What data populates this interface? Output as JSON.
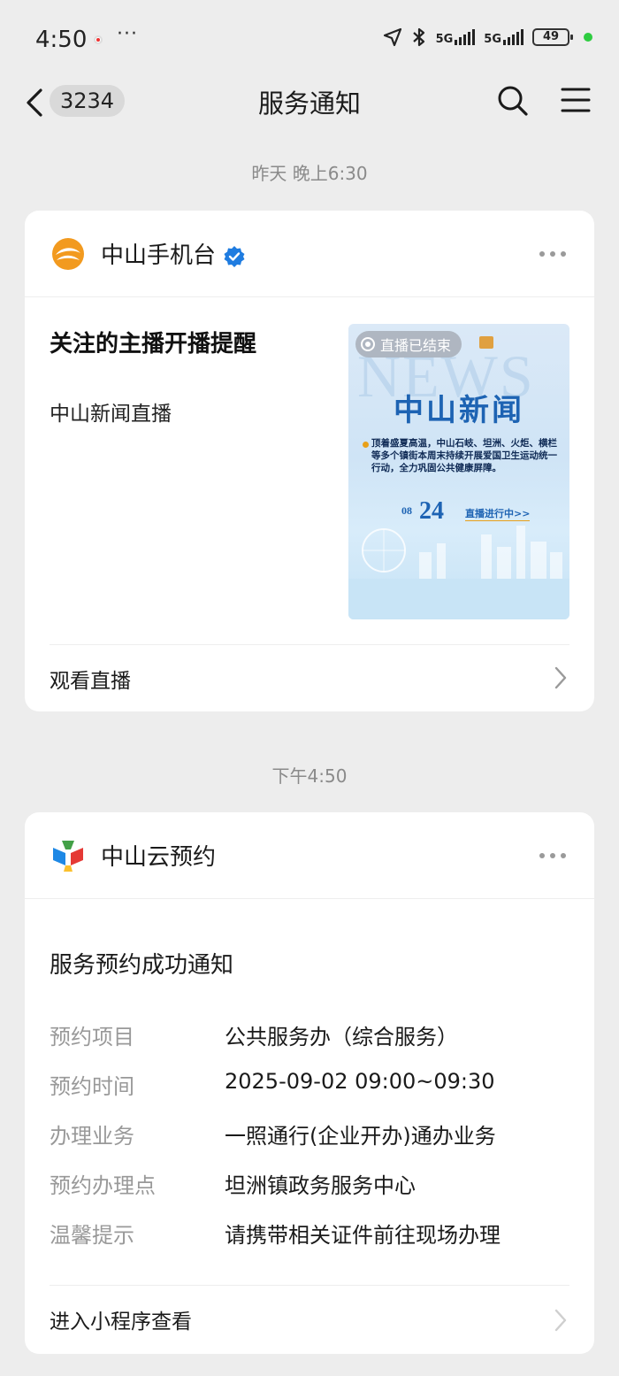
{
  "status_bar": {
    "time": "4:50",
    "more": "···",
    "signal1_label": "5G",
    "signal2_label": "5G",
    "battery": "49"
  },
  "nav": {
    "badge_count": "3234",
    "title": "服务通知"
  },
  "messages": [
    {
      "timestamp": "昨天 晚上6:30",
      "sender": "中山手机台",
      "title": "关注的主播开播提醒",
      "subtitle": "中山新闻直播",
      "thumbnail": {
        "live_status": "直播已结束",
        "watermark": "NEWS",
        "headline": "中山新闻",
        "text": "顶着盛夏高温，中山石岐、坦洲、火炬、横栏等多个镇街本周末持续开展爱国卫生运动统一行动，全力巩固公共健康屏障。",
        "month": "08",
        "day": "24",
        "link": "直播进行中>>"
      },
      "footer_action": "观看直播"
    },
    {
      "timestamp": "下午4:50",
      "sender": "中山云预约",
      "title": "服务预约成功通知",
      "fields": [
        {
          "label": "预约项目",
          "value": "公共服务办（综合服务）"
        },
        {
          "label": "预约时间",
          "value": "2025-09-02 09:00~09:30"
        },
        {
          "label": "办理业务",
          "value": "一照通行(企业开办)通办业务"
        },
        {
          "label": "预约办理点",
          "value": "坦洲镇政务服务中心"
        },
        {
          "label": "温馨提示",
          "value": "请携带相关证件前往现场办理"
        }
      ],
      "footer_action": "进入小程序查看"
    }
  ],
  "colors": {
    "background": "#ededed",
    "card": "#ffffff",
    "verified": "#1f7ce0",
    "thumb_title": "#1d63b3",
    "online": "#2ecc40"
  }
}
